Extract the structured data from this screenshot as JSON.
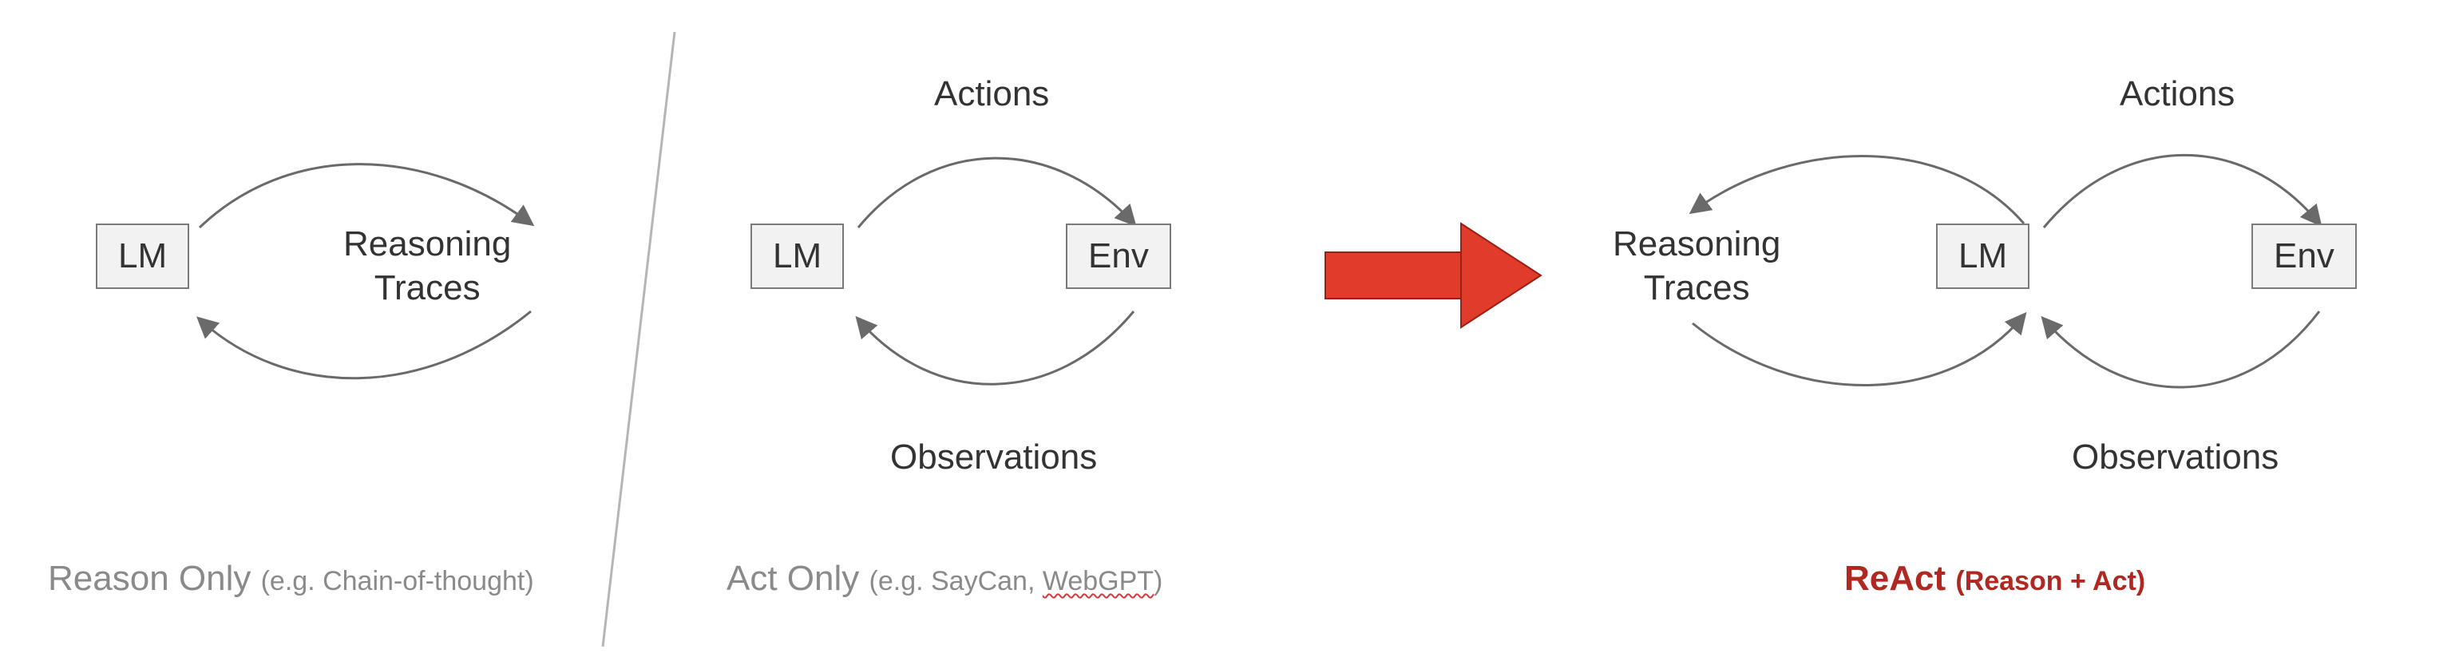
{
  "panels": {
    "reason_only": {
      "lm_box": "LM",
      "traces_label": "Reasoning\nTraces",
      "caption_main": "Reason Only",
      "caption_sub": "(e.g. Chain-of-thought)"
    },
    "act_only": {
      "lm_box": "LM",
      "env_box": "Env",
      "actions_label": "Actions",
      "observations_label": "Observations",
      "caption_main": "Act Only",
      "caption_sub_prefix": "(e.g. SayCan, ",
      "caption_sub_squiggle": "WebGPT",
      "caption_sub_suffix": ")"
    },
    "react": {
      "lm_box": "LM",
      "env_box": "Env",
      "traces_label": "Reasoning\nTraces",
      "actions_label": "Actions",
      "observations_label": "Observations",
      "caption_main": "ReAct",
      "caption_sub": "(Reason + Act)"
    }
  }
}
